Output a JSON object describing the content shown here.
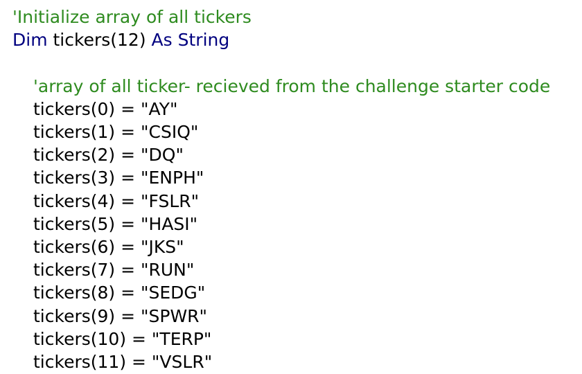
{
  "editor": {
    "colors": {
      "comment": "#2e8b1f",
      "keyword": "#00007f",
      "text": "#000000",
      "background": "#ffffff"
    },
    "lines": [
      {
        "indent": 0,
        "tokens": [
          {
            "kind": "comment",
            "text": "'Initialize array of all tickers"
          }
        ]
      },
      {
        "indent": 0,
        "tokens": [
          {
            "kind": "keyword",
            "text": "Dim"
          },
          {
            "kind": "plain",
            "text": " tickers(12) "
          },
          {
            "kind": "keyword",
            "text": "As String"
          }
        ]
      },
      {
        "indent": 0,
        "tokens": []
      },
      {
        "indent": 1,
        "tokens": [
          {
            "kind": "comment",
            "text": "'array of all ticker- recieved from the challenge starter code"
          }
        ]
      },
      {
        "indent": 1,
        "tokens": [
          {
            "kind": "plain",
            "text": "tickers(0) = \"AY\""
          }
        ]
      },
      {
        "indent": 1,
        "tokens": [
          {
            "kind": "plain",
            "text": "tickers(1) = \"CSIQ\""
          }
        ]
      },
      {
        "indent": 1,
        "tokens": [
          {
            "kind": "plain",
            "text": "tickers(2) = \"DQ\""
          }
        ]
      },
      {
        "indent": 1,
        "tokens": [
          {
            "kind": "plain",
            "text": "tickers(3) = \"ENPH\""
          }
        ]
      },
      {
        "indent": 1,
        "tokens": [
          {
            "kind": "plain",
            "text": "tickers(4) = \"FSLR\""
          }
        ]
      },
      {
        "indent": 1,
        "tokens": [
          {
            "kind": "plain",
            "text": "tickers(5) = \"HASI\""
          }
        ]
      },
      {
        "indent": 1,
        "tokens": [
          {
            "kind": "plain",
            "text": "tickers(6) = \"JKS\""
          }
        ]
      },
      {
        "indent": 1,
        "tokens": [
          {
            "kind": "plain",
            "text": "tickers(7) = \"RUN\""
          }
        ]
      },
      {
        "indent": 1,
        "tokens": [
          {
            "kind": "plain",
            "text": "tickers(8) = \"SEDG\""
          }
        ]
      },
      {
        "indent": 1,
        "tokens": [
          {
            "kind": "plain",
            "text": "tickers(9) = \"SPWR\""
          }
        ]
      },
      {
        "indent": 1,
        "tokens": [
          {
            "kind": "plain",
            "text": "tickers(10) = \"TERP\""
          }
        ]
      },
      {
        "indent": 1,
        "tokens": [
          {
            "kind": "plain",
            "text": "tickers(11) = \"VSLR\""
          }
        ]
      }
    ]
  }
}
